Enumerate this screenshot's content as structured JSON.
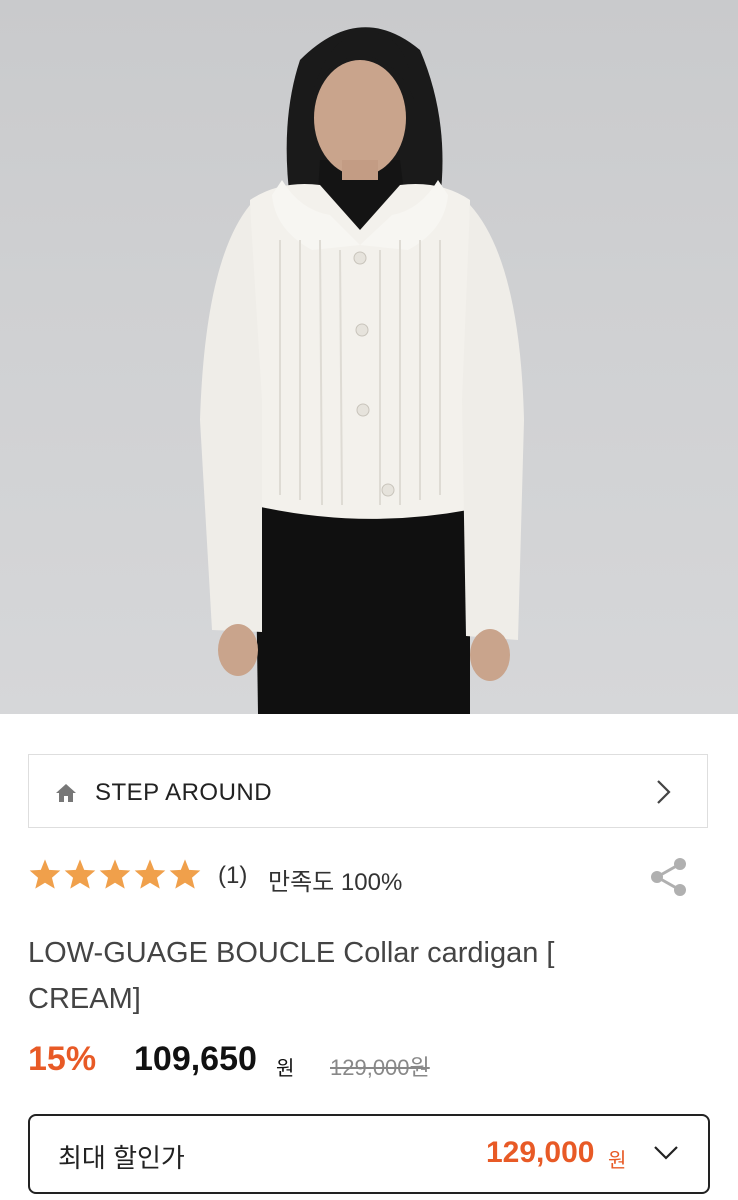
{
  "hero": {
    "image_alt": "model wearing cream boucle collar cardigan"
  },
  "brand": {
    "name": "STEP AROUND",
    "home_icon": "home-icon",
    "nav_icon": "chevron-right-icon"
  },
  "rating": {
    "stars": 5,
    "max_stars": 5,
    "review_count": "(1)",
    "satisfaction": "만족도 100%",
    "star_color": "#f0a04b"
  },
  "product": {
    "title": "LOW-GUAGE BOUCLE Collar cardigan [ CREAM]"
  },
  "price": {
    "discount": "15%",
    "sale_price": "109,650",
    "sale_unit": "원",
    "original_price": "129,000원",
    "discount_color": "#e85a26"
  },
  "max_discount": {
    "label": "최대 할인가",
    "price": "129,000",
    "unit": "원",
    "toggle_icon": "chevron-down-icon"
  }
}
